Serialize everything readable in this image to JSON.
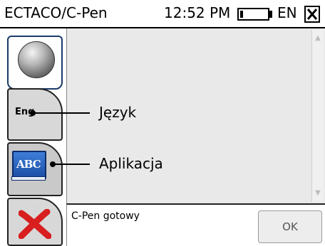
{
  "titlebar": {
    "app_title": "ECTACO/C-Pen",
    "clock": "12:52 PM",
    "battery_level": 0.1,
    "language": "EN",
    "close_icon": "close-box-icon"
  },
  "toolbar": {
    "buttons": [
      {
        "icon": "sphere-icon"
      },
      {
        "icon": "language-icon",
        "label": "Eng"
      },
      {
        "icon": "abc-book-icon",
        "label": "ABC"
      },
      {
        "icon": "red-x-icon"
      }
    ]
  },
  "callouts": {
    "language": "Język",
    "application": "Aplikacja"
  },
  "status": {
    "text": "C-Pen gotowy",
    "ok_label": "OK"
  },
  "colors": {
    "content_bg": "#e9e9e9",
    "abc_blue": "#1b4ea4",
    "x_red": "#d81e1e"
  }
}
